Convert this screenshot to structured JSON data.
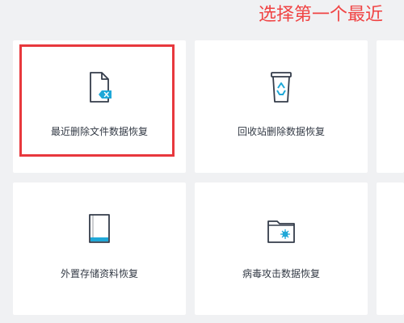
{
  "annotation": {
    "text": "选择第一个最近",
    "color": "#f04343"
  },
  "cards": [
    {
      "label": "最近删除文件数据恢复",
      "icon": "deleted-file-icon"
    },
    {
      "label": "回收站删除数据恢复",
      "icon": "recycle-bin-icon"
    },
    {
      "label": "外置存储资料恢复",
      "icon": "external-storage-icon"
    },
    {
      "label": "病毒攻击数据恢复",
      "icon": "virus-folder-icon"
    }
  ],
  "colors": {
    "accent": "#1fa8d8",
    "icon_stroke": "#343c4a",
    "highlight": "#e8383d",
    "background": "#f0f1f3",
    "card": "#ffffff"
  }
}
